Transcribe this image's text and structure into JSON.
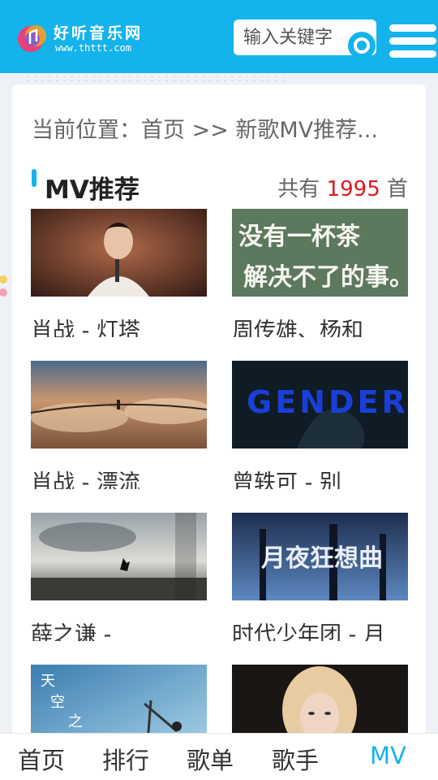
{
  "header": {
    "logo_text": "好听音乐网",
    "logo_url": "www.thttt.com",
    "search_placeholder": "输入关键字",
    "brand_color": "#14b3ec"
  },
  "breadcrumb": {
    "prefix": "当前位置：",
    "home": "首页",
    "separator": " >> ",
    "current": "新歌MV推荐..."
  },
  "section": {
    "title": "MV推荐",
    "count_prefix": "共有 ",
    "count": "1995",
    "count_suffix": " 首"
  },
  "mv_list": [
    {
      "title": "肖战 - 灯塔",
      "thumb_overlay": ""
    },
    {
      "title": "周传雄、杨和",
      "thumb_overlay": "没有一杯茶 解决不了的事。"
    },
    {
      "title": "肖战 - 漂流",
      "thumb_overlay": ""
    },
    {
      "title": "曾轶可 - 别",
      "thumb_overlay": "GENDER"
    },
    {
      "title": "薛之谦 -",
      "thumb_overlay": ""
    },
    {
      "title": "时代少年团 - 月",
      "thumb_overlay": "月夜狂想曲"
    },
    {
      "title": "",
      "thumb_overlay": "天 空 之 外"
    },
    {
      "title": "",
      "thumb_overlay": ""
    }
  ],
  "bottom_nav": [
    {
      "label": "首页",
      "active": false
    },
    {
      "label": "排行",
      "active": false
    },
    {
      "label": "歌单",
      "active": false
    },
    {
      "label": "歌手",
      "active": false
    },
    {
      "label": "MV",
      "active": true
    }
  ]
}
